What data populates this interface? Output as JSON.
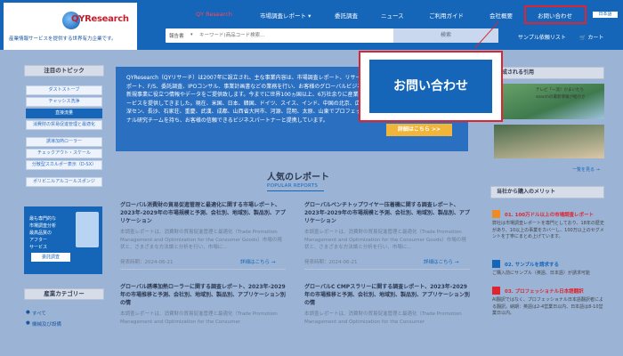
{
  "header": {
    "logo_text": "QYResearch",
    "logo_tagline": "産業情報サービスを提供する世界有力企業です。",
    "nav": [
      {
        "label": "QY Research",
        "active": true
      },
      {
        "label": "市場調査レポート ▾",
        "active": false
      },
      {
        "label": "委託調査",
        "active": false
      },
      {
        "label": "ニュース",
        "active": false
      },
      {
        "label": "ご利用ガイド",
        "active": false
      },
      {
        "label": "会社概要",
        "active": false
      },
      {
        "label": "お問い合わせ",
        "active": false
      }
    ],
    "lang": "日本語",
    "search": {
      "category": "報告書",
      "placeholder": "キーワード(商品コード検索...",
      "button": "検索"
    },
    "sample_link": "サンプル依頼リスト",
    "cart_label": "カート"
  },
  "callout": {
    "label": "お問い合わせ"
  },
  "sidebar": {
    "topics_title": "注目のトピック",
    "topics": [
      "ダストストーブ",
      "チャッシス洗浄",
      "直接流量",
      "消費財の貿易促進管理と最適化",
      "誘導加熱ローラー",
      "チェックアウト・スケール",
      "分散型スカルポー表示（D-SX）",
      "ポリビニルアルコールスポンジ"
    ],
    "promo_text": [
      "最も専門的な",
      "市場調査分析",
      "最高品質の",
      "アフター",
      "サービス"
    ],
    "promo_button": "委託調査",
    "category_title": "産業カテゴリー",
    "categories": [
      "すべて",
      "機械及び設備"
    ]
  },
  "hero": {
    "text": "QYResearch（QYリサーチ）は2007年に設立され、主な事業内容は、市場調査レポート、リサーチレポート、F/S、委託調査、IPOコンサル、事業計画書などの業務を行い、お客様のグローバルビジネス、新規事業に役立つ情報やデータをご提供致します。今までに世界100ヵ国以上、6万社余りに産業情報サービスを提供してきました。現在、米国、日本、韓国、ドイツ、スイス、インド、中国の北京、広州、深セン、長沙、石家荘、重慶、武漢、成都、山西省大同市、河源、昆明、太原、山東でプロフェッショナル研究チームを持ち、お客様の信頼できるビジネスパートナーと提携しています。",
    "button": "詳細はこちら >>"
  },
  "popular": {
    "title": "人気のレポート",
    "subtitle": "POPULAR REPORTS",
    "reports": [
      {
        "title": "グローバル消費財の貿易促進管理と最適化に関する市場レポート、2023年-2029年の市場規模と予測、会社別、地域別、製品別、アプリケーション",
        "desc": "本調査レポートは、消費財の貿易促進管理と最適化（Trade Promotion Management and Optimization for the Consumer Goods）市場の現状と、さまざまな方法論と分析を行い、市場に...",
        "date": "発表時期：2024-06-21",
        "more": "詳細はこちら →"
      },
      {
        "title": "グローバルベンチトップワイヤー压着機に関する調査レポート、2023年-2029年の市場規模と予測、会社別、地域別、製品別、アプリケーション",
        "desc": "本調査レポートは、消費財の貿易促進管理と最適化（Trade Promotion Management and Optimization for the Consumer Goods）市場の現状と、さまざまな方法論と分析を行い、市場に...",
        "date": "発表時期：2024-06-21",
        "more": "詳細はこちら →"
      },
      {
        "title": "グローバル誘導加熱ローラーに関する調査レポート、2023年-2029年の市場推移と予測、会社別、地域別、製品別、アプリケーション別の情",
        "desc": "本調査レポートは、消費財の貿易促進管理と最適化（Trade Promotion Management and Optimization for the Consumer"
      },
      {
        "title": "グローバルC CMPスラリーに関する調査レポート、2023年-2029年の市場推移と予測、会社別、地域別、製品別、アプリケーション別の情",
        "desc": "本調査レポートは、消費財の貿易促進管理と最適化（Trade Promotion Management and Optimization for the Consumer"
      }
    ]
  },
  "right": {
    "citations_title": "構成される引用",
    "citation_captions": [
      "テレビ「一流！かまいたち",
      "searchの最新情報が紹介さ",
      "一覧を見る →"
    ],
    "merits_title": "当社から購入のメリット",
    "merits": [
      {
        "title": "01. 100万ドル以上の市場調査レポート",
        "body": "弊社は市場調査レポートを専門としており、18年の歴史があり、10以上の事業をカバーし、100万以上のセグメントを丁寧にまとめ上げています。",
        "color": "#e0242f"
      },
      {
        "title": "02. サンプルを請求する",
        "body": "ご購入前にサンプル（英語、日本語）が請求可能",
        "color": "#1565b8"
      },
      {
        "title": "03. プロフェッショナル日本語翻訳",
        "body": "AI翻訳ではなく、プロフェッショナル日本語翻訳者による翻訳。納期：英語は2-4営業日以内、日本語は8-10営業日以内。",
        "color": "#e0242f"
      }
    ]
  }
}
